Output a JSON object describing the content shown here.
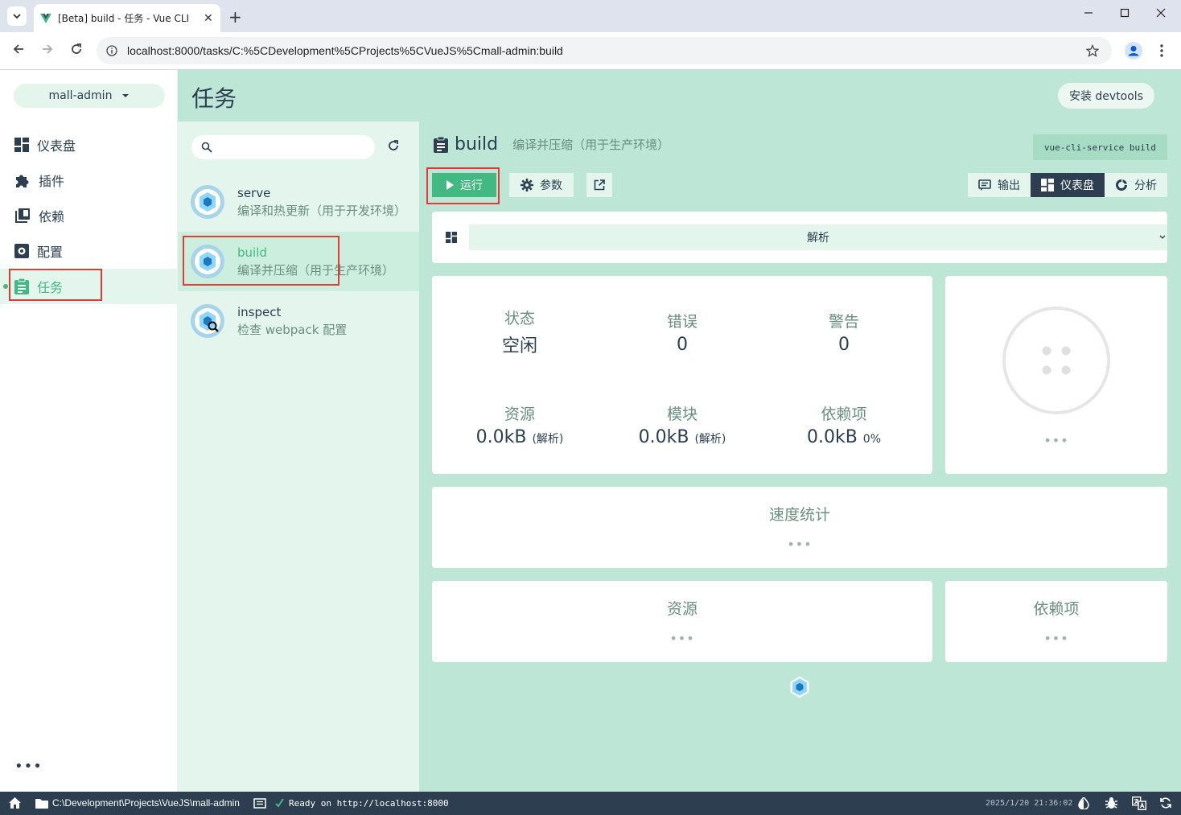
{
  "browser": {
    "tab_title": "[Beta] build - 任务 - Vue CLI",
    "tab_close": "✕",
    "new_tab": "+",
    "url": "localhost:8000/tasks/C:%5CDevelopment%5CProjects%5CVueJS%5Cmall-admin:build"
  },
  "sidebar": {
    "project": "mall-admin",
    "items": [
      {
        "label": "仪表盘",
        "icon": "dashboard-icon"
      },
      {
        "label": "插件",
        "icon": "puzzle-icon"
      },
      {
        "label": "依赖",
        "icon": "library-icon"
      },
      {
        "label": "配置",
        "icon": "settings-box-icon"
      },
      {
        "label": "任务",
        "icon": "clipboard-icon"
      }
    ],
    "more": "•••"
  },
  "header": {
    "title": "任务",
    "devtools_button": "安装 devtools"
  },
  "tasks": [
    {
      "name": "serve",
      "desc": "编译和热更新（用于开发环境）"
    },
    {
      "name": "build",
      "desc": "编译并压缩（用于生产环境）"
    },
    {
      "name": "inspect",
      "desc": "检查 webpack 配置"
    }
  ],
  "detail": {
    "name": "build",
    "desc": "编译并压缩（用于生产环境）",
    "command": "vue-cli-service build",
    "run_label": "运行",
    "params_label": "参数",
    "view_tabs": [
      "输出",
      "仪表盘",
      "分析"
    ],
    "analyzer_select": "解析",
    "stats": {
      "status_label": "状态",
      "status_value": "空闲",
      "errors_label": "错误",
      "errors_value": "0",
      "warnings_label": "警告",
      "warnings_value": "0",
      "assets_label": "资源",
      "assets_value": "0.0kB",
      "assets_sub": "(解析)",
      "modules_label": "模块",
      "modules_value": "0.0kB",
      "modules_sub": "(解析)",
      "deps_label": "依赖项",
      "deps_value": "0.0kB",
      "deps_sub": "0%"
    },
    "progress_dots": "•••",
    "speed_title": "速度统计",
    "speed_dots": "•••",
    "assets_title": "资源",
    "assets_dots": "•••",
    "deps_title": "依赖项",
    "deps_dots": "•••"
  },
  "statusbar": {
    "path": "C:\\Development\\Projects\\VueJS\\mall-admin",
    "log": "Ready on http://localhost:8000",
    "time": "2025/1/20 21:36:02"
  },
  "colors": {
    "accent": "#42b983",
    "dark": "#2c3e50",
    "mint": "#bde6d6",
    "mint_light": "#e3f5ec"
  }
}
